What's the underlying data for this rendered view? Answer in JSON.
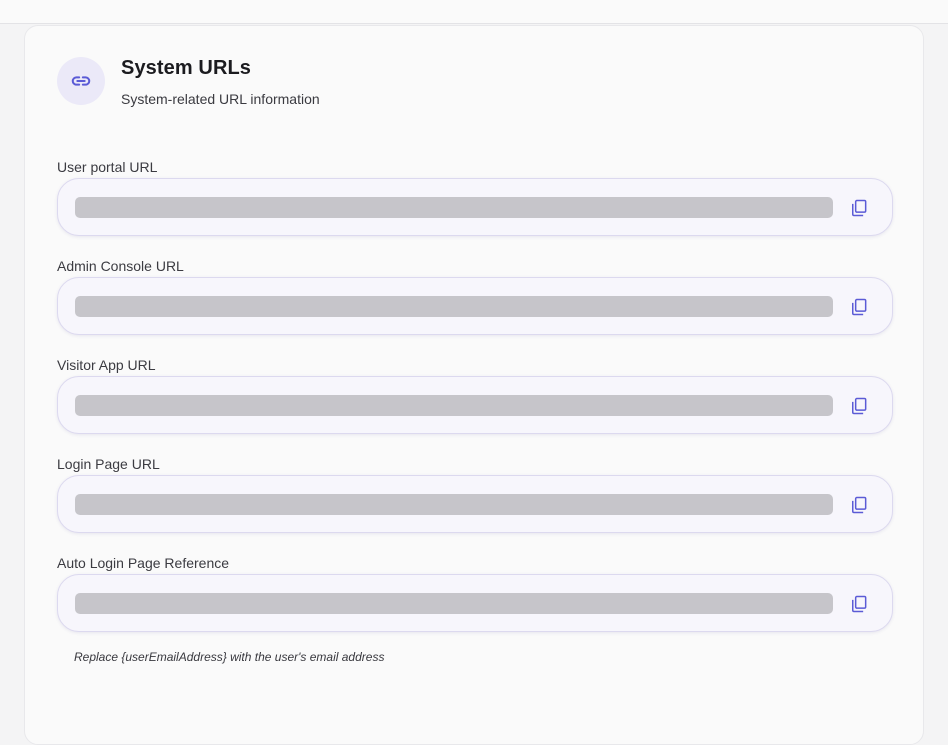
{
  "header": {
    "icon": "link-icon",
    "title": "System URLs",
    "subtitle": "System-related URL information"
  },
  "fields": [
    {
      "label": "User portal URL",
      "value_redacted": true,
      "copy_icon": "copy-icon",
      "focused": true
    },
    {
      "label": "Admin Console URL",
      "value_redacted": true,
      "copy_icon": "copy-icon"
    },
    {
      "label": "Visitor App URL",
      "value_redacted": true,
      "copy_icon": "copy-icon"
    },
    {
      "label": "Login Page URL",
      "value_redacted": true,
      "copy_icon": "copy-icon"
    },
    {
      "label": "Auto Login Page Reference",
      "value_redacted": true,
      "copy_icon": "copy-icon"
    }
  ],
  "note": "Replace {userEmailAddress} with the user's email address",
  "colors": {
    "accent": "#5b5bd6",
    "focus_ring": "#f0a21a",
    "redaction": "#c6c5ca"
  }
}
